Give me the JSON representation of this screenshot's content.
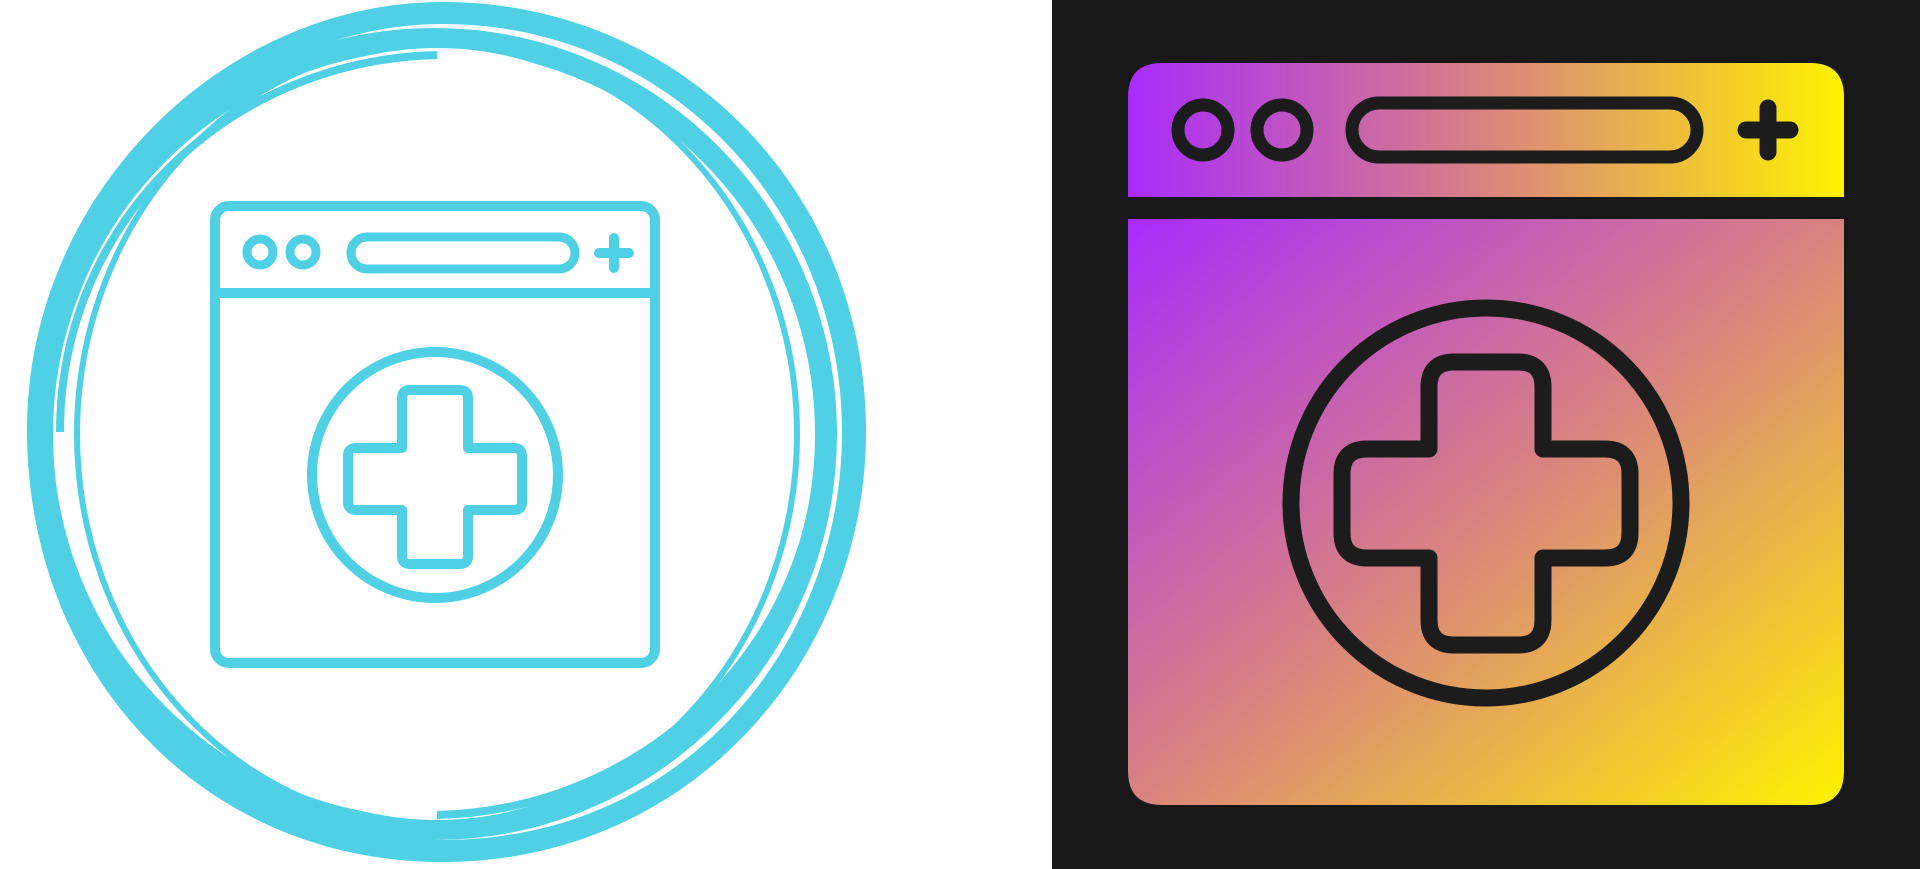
{
  "icons": [
    {
      "name": "medical-browser-icon",
      "style": "line",
      "colors": {
        "stroke": "#4fd0e4",
        "background": "#ffffff"
      }
    },
    {
      "name": "medical-browser-icon",
      "style": "gradient-glyph",
      "colors": {
        "background": "#181818",
        "stroke": "#1c1c1c",
        "gradient_start": "#a92bfc",
        "gradient_mid": "#d98380",
        "gradient_end": "#fff200"
      }
    }
  ]
}
